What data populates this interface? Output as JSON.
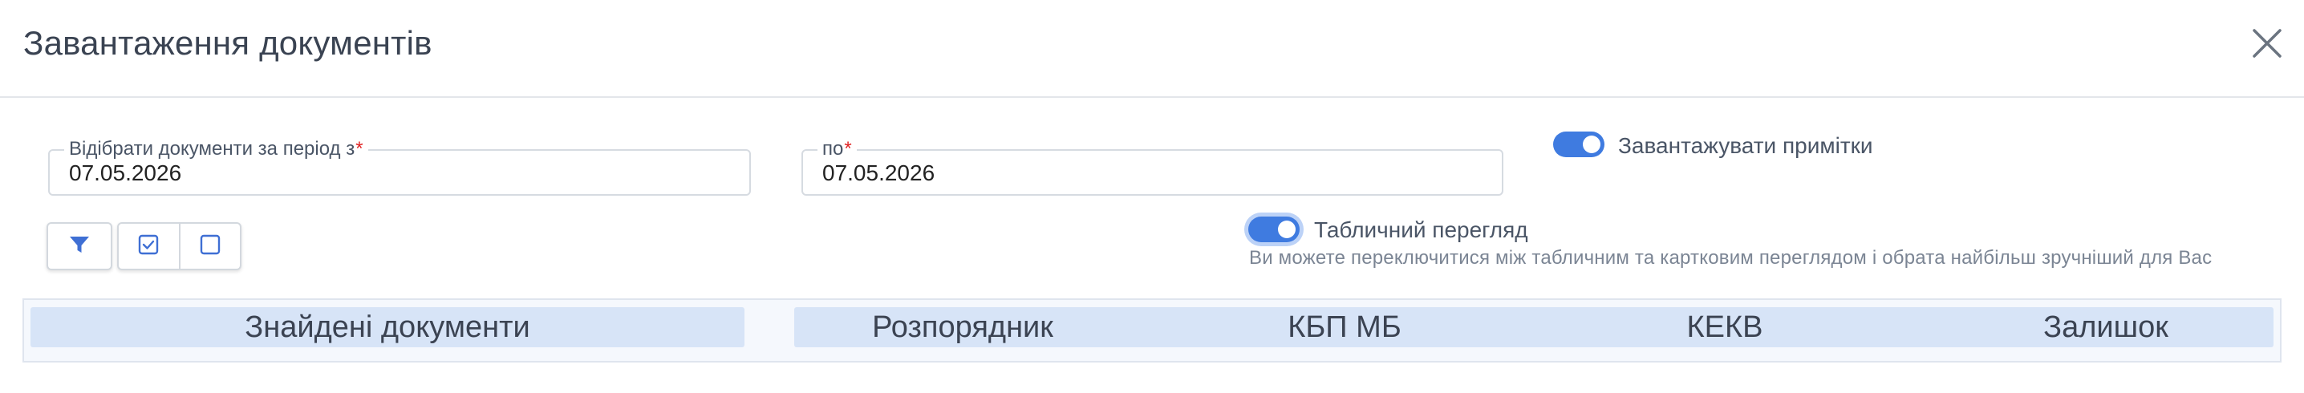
{
  "dialog": {
    "title": "Завантаження документів"
  },
  "period": {
    "from_label": "Відібрати документи за період з",
    "from_value": "07.05.2026",
    "to_label": "по",
    "to_value": "07.05.2026",
    "required_mark": "*"
  },
  "toggles": {
    "notes_label": "Завантажувати примітки",
    "notes_on": true,
    "table_view_label": "Табличний перегляд",
    "table_view_on": true,
    "table_view_hint": "Ви можете переключитися між табличним та картковим переглядом і обрата найбільш зручніший для Вас"
  },
  "toolbar": {
    "icons": [
      "filter-icon",
      "checked-checkbox-icon",
      "empty-checkbox-icon"
    ]
  },
  "grid": {
    "left_header": "Знайдені документи",
    "columns": [
      "Розпорядник",
      "КБП МБ",
      "КЕКВ",
      "Залишок"
    ]
  },
  "colors": {
    "accent": "#3f7be0",
    "header_band": "#d7e4f7",
    "required": "#e02424"
  }
}
